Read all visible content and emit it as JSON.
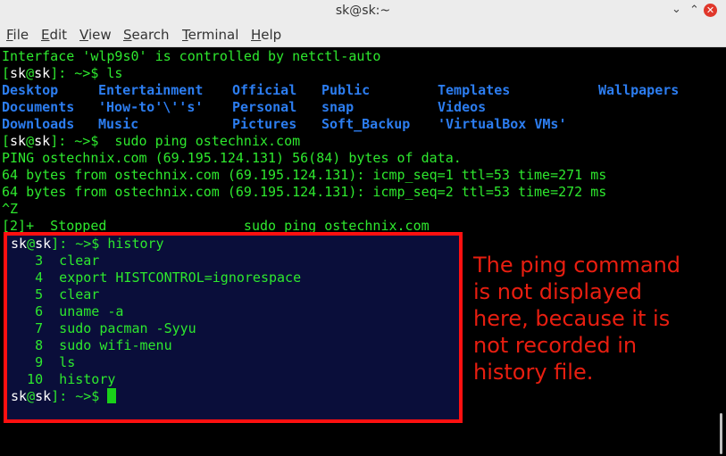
{
  "window": {
    "title": "sk@sk:~",
    "minimize_glyph": "⌄",
    "maximize_glyph": "⌃",
    "close_glyph": "✕"
  },
  "menu": [
    {
      "first": "F",
      "rest": "ile"
    },
    {
      "first": "E",
      "rest": "dit"
    },
    {
      "first": "V",
      "rest": "iew"
    },
    {
      "first": "S",
      "rest": "earch"
    },
    {
      "first": "T",
      "rest": "erminal"
    },
    {
      "first": "H",
      "rest": "elp"
    }
  ],
  "terminal": {
    "line_interface": "Interface 'wlp9s0' is controlled by netctl-auto",
    "prompt": {
      "open": "[",
      "user": "sk",
      "at": "@",
      "host": "sk",
      "close": "]",
      "path": ": ~>$ "
    },
    "cmd_ls": "ls",
    "ls_dirs": [
      [
        "Desktop",
        "Entertainment",
        "Official",
        "Public",
        "Templates",
        "Wallpapers"
      ],
      [
        "Documents",
        "'How-to'\\''s'",
        "Personal",
        "snap",
        "Videos"
      ],
      [
        "Downloads",
        "Music",
        "Pictures",
        "Soft_Backup",
        "'VirtualBox VMs'"
      ]
    ],
    "cmd_ping": " sudo ping ostechnix.com",
    "ping_lines": [
      "PING ostechnix.com (69.195.124.131) 56(84) bytes of data.",
      "64 bytes from ostechnix.com (69.195.124.131): icmp_seq=1 ttl=53 time=271 ms",
      "64 bytes from ostechnix.com (69.195.124.131): icmp_seq=2 ttl=53 time=272 ms",
      "^Z",
      "[2]+  Stopped                 sudo ping ostechnix.com"
    ],
    "cmd_history": "history",
    "history_entries": [
      "   3  clear",
      "   4  export HISTCONTROL=ignorespace",
      "   5  clear",
      "   6  uname -a",
      "   7  sudo pacman -Syyu",
      "   8  sudo wifi-menu",
      "   9  ls",
      "  10  history"
    ]
  },
  "annotation": {
    "lines": [
      "The ping command",
      "is not displayed",
      "here, because it is",
      "not recorded in",
      "history file."
    ]
  },
  "colors": {
    "terminal_bg": "#000000",
    "text_green": "#2ee82e",
    "dir_blue": "#2c7df0",
    "highlight_bg": "#0a0e3a",
    "highlight_border": "#ff1010",
    "annotation_red": "#e81e10"
  }
}
